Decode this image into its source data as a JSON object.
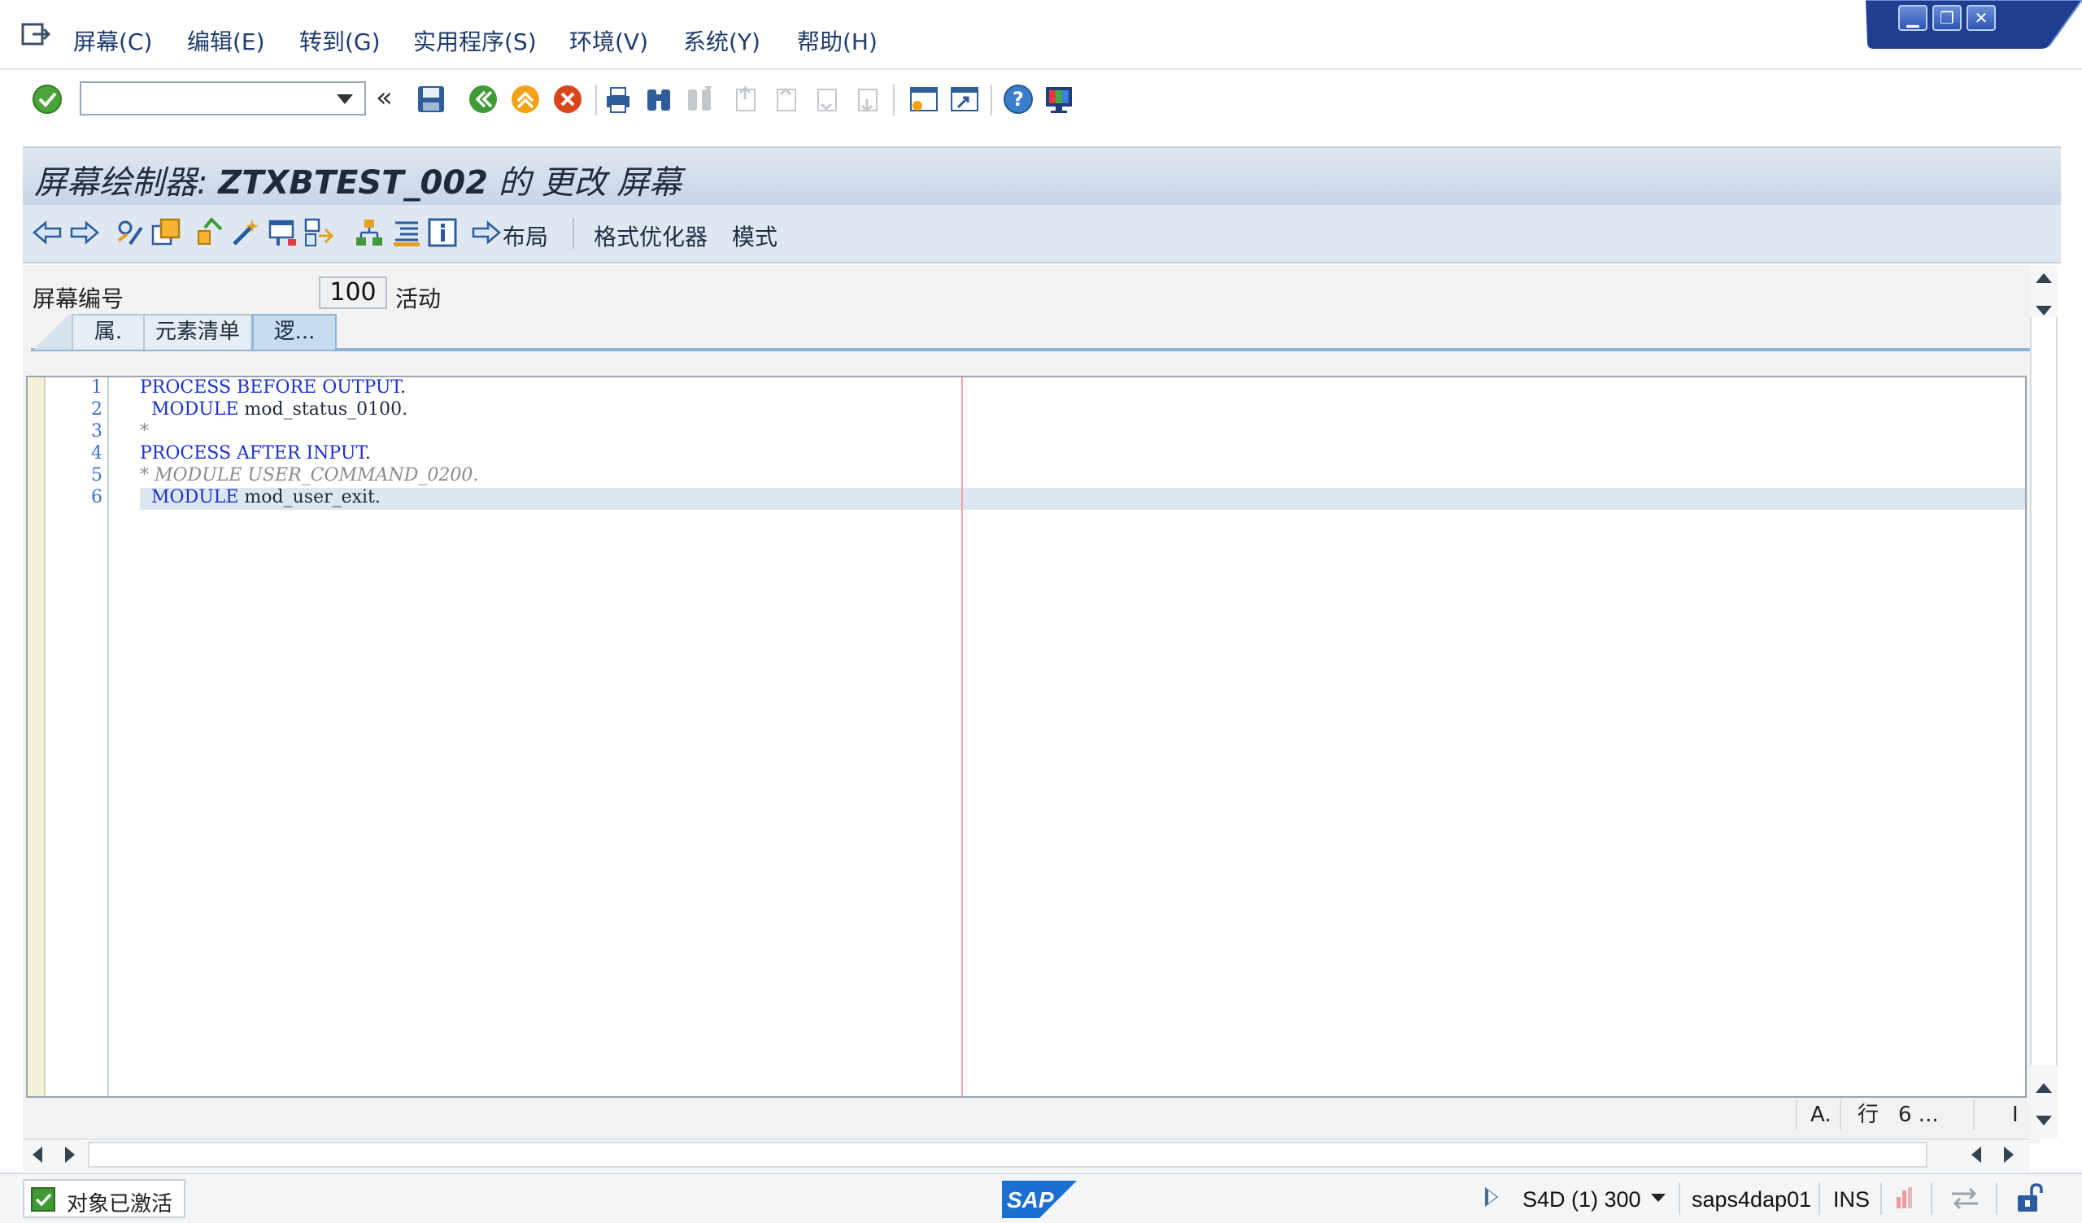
{
  "menu": {
    "items": [
      "屏幕(C)",
      "编辑(E)",
      "转到(G)",
      "实用程序(S)",
      "环境(V)",
      "系统(Y)",
      "帮助(H)"
    ]
  },
  "toolbar": {
    "command_value": "",
    "icons": [
      "enter-icon",
      "dropdown-icon",
      "collapse-icon",
      "save-icon",
      "back-icon",
      "exit-icon",
      "cancel-icon",
      "print-icon",
      "find-icon",
      "find-next-icon",
      "first-page-icon",
      "prev-page-icon",
      "next-page-icon",
      "last-page-icon",
      "new-session-icon",
      "shortcut-icon",
      "help-icon",
      "customize-layout-icon"
    ]
  },
  "title": {
    "prefix": "屏幕绘制器:",
    "program": "ZTXBTEST_002",
    "suffix": "的 更改 屏幕"
  },
  "app_toolbar": {
    "layout_label": "布局",
    "pretty_printer_label": "格式优化器",
    "pattern_label": "模式"
  },
  "screen": {
    "number_label": "屏幕编号",
    "number": "100",
    "status": "活动"
  },
  "tabs": [
    {
      "label": "属.",
      "active": false
    },
    {
      "label": "元素清单",
      "active": false
    },
    {
      "label": "逻...",
      "active": true
    }
  ],
  "code": {
    "lines": [
      {
        "no": "1",
        "indent": "",
        "kw": "PROCESS BEFORE OUTPUT",
        "rest": ".",
        "comment": false
      },
      {
        "no": "2",
        "indent": "  ",
        "kw": "MODULE",
        "rest": " mod_status_0100.",
        "comment": false
      },
      {
        "no": "3",
        "indent": "",
        "kw": "",
        "rest": "*",
        "comment": true
      },
      {
        "no": "4",
        "indent": "",
        "kw": "PROCESS AFTER INPUT",
        "rest": ".",
        "comment": false
      },
      {
        "no": "5",
        "indent": "",
        "kw": "",
        "rest": "* MODULE USER_COMMAND_0200.",
        "comment": true
      },
      {
        "no": "6",
        "indent": "  ",
        "kw": "MODULE",
        "rest": " mod_user_exit.",
        "comment": false
      }
    ],
    "current_line": 6
  },
  "editor_status": {
    "mode": "A.",
    "line_label": "行",
    "line_value": "6 ...",
    "col_marker": "I"
  },
  "statusbar": {
    "message": "对象已激活",
    "system": "S4D (1) 300",
    "server": "saps4dap01",
    "insert_mode": "INS",
    "logo_text": "SAP"
  },
  "colors": {
    "keyword": "#1a2fd6",
    "comment": "#8b8b8b",
    "line_number": "#3b6fd0",
    "title_bg": "#c7d6e6",
    "tab_active": "#c7dcf1",
    "sap_blue": "#1b6fd1"
  }
}
